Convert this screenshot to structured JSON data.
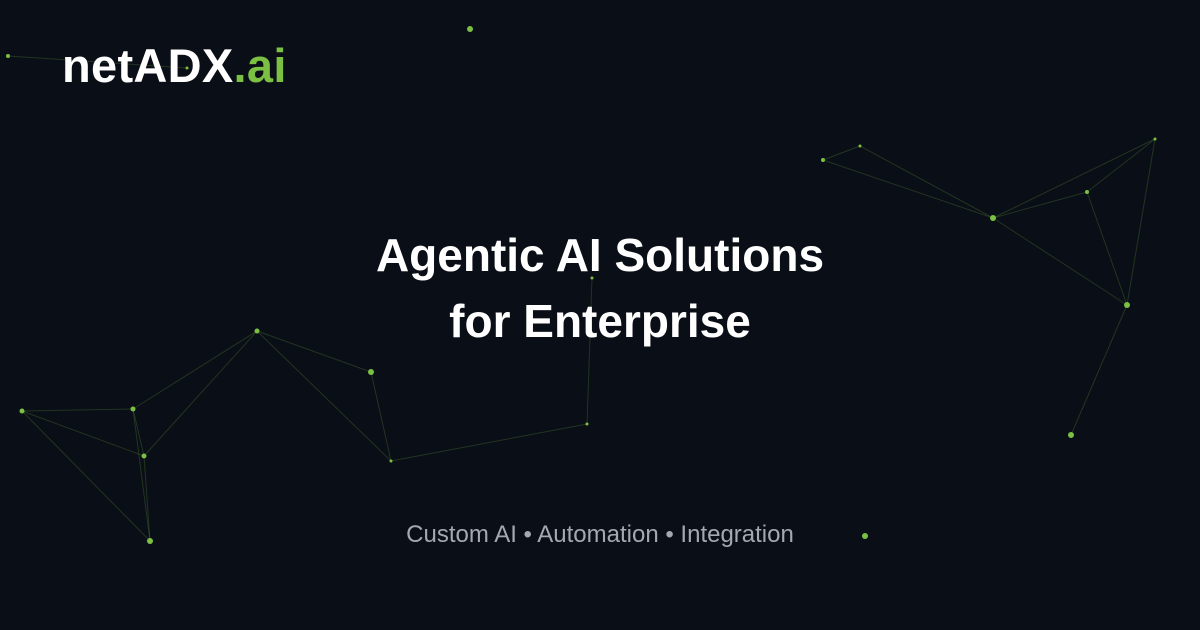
{
  "brand": {
    "name": "netADX",
    "suffix": ".ai",
    "accent_color": "#7bc043",
    "text_color": "#ffffff"
  },
  "headline": {
    "line1": "Agentic AI Solutions",
    "line2": "for Enterprise"
  },
  "tagline": "Custom AI • Automation • Integration",
  "background_color": "#0a0e17",
  "node_color": "#7bc043"
}
